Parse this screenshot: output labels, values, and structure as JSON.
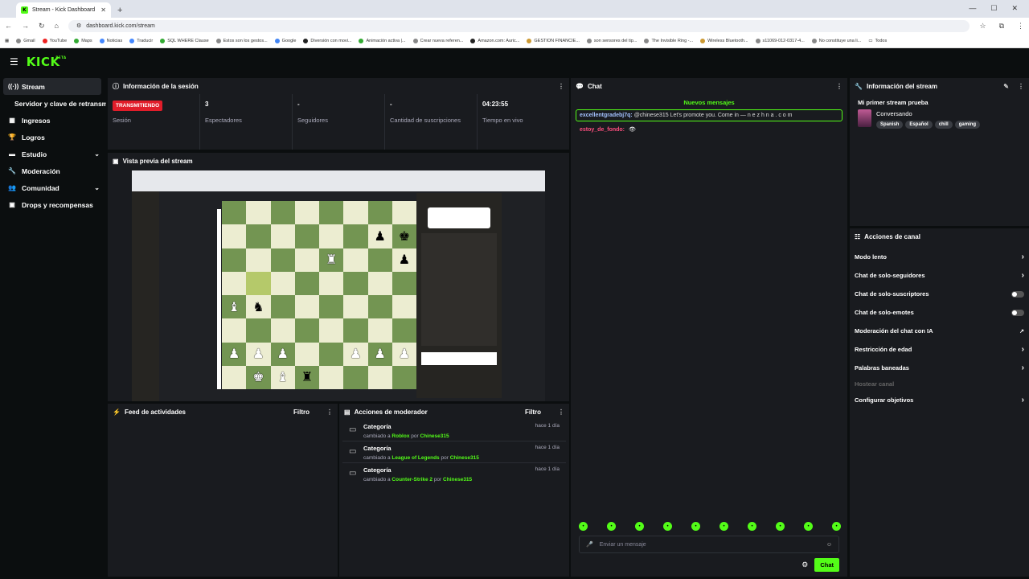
{
  "browser": {
    "tab_title": "Stream - Kick Dashboard",
    "tab_favicon": "K",
    "url": "dashboard.kick.com/stream",
    "bookmarks": [
      "Gmail",
      "YouTube",
      "Maps",
      "Noticias",
      "Traducir",
      "SQL WHERE Clause",
      "Estos son los gestos...",
      "Google",
      "Diversión con movi...",
      "Animación activa |...",
      "Crear nueva referen...",
      "Amazon.com: Auric...",
      "GESTION FINANCIE...",
      "son sensores del tip...",
      "The Invisible Ring -...",
      "Wireless Bluetooth...",
      "s11069-012-0317-4...",
      "No constituye una li...",
      "Todos"
    ]
  },
  "brand": {
    "logo": "KICK",
    "logo_sup": "BETA",
    "accent": "#53fc18"
  },
  "sidebar": {
    "items": [
      {
        "label": "Stream",
        "icon": "stream-icon"
      },
      {
        "label": "Servidor y clave de retransmisión"
      },
      {
        "label": "Ingresos",
        "icon": "revenue-icon"
      },
      {
        "label": "Logros",
        "icon": "trophy-icon"
      },
      {
        "label": "Estudio",
        "icon": "studio-icon"
      },
      {
        "label": "Moderación",
        "icon": "wrench-icon"
      },
      {
        "label": "Comunidad",
        "icon": "community-icon"
      },
      {
        "label": "Drops y recompensas",
        "icon": "drops-icon"
      }
    ]
  },
  "session": {
    "title": "Información de la sesión",
    "stats": [
      {
        "value": "TRANSMITIENDO",
        "label": "Sesión"
      },
      {
        "value": "3",
        "label": "Espectadores"
      },
      {
        "value": "-",
        "label": "Seguidores"
      },
      {
        "value": "-",
        "label": "Cantidad de suscripciones"
      },
      {
        "value": "04:23:55",
        "label": "Tiempo en vivo"
      }
    ]
  },
  "preview": {
    "title": "Vista previa del stream"
  },
  "activity": {
    "title": "Feed de actividades",
    "filter": "Filtro"
  },
  "mod_actions": {
    "title": "Acciones de moderador",
    "filter": "Filtro",
    "items": [
      {
        "title": "Categoría",
        "prefix": "cambiado a",
        "target": "Roblox",
        "by": "por",
        "user": "Chinese315",
        "time": "hace 1 día"
      },
      {
        "title": "Categoría",
        "prefix": "cambiado a",
        "target": "League of Legends",
        "by": "por",
        "user": "Chinese315",
        "time": "hace 1 día"
      },
      {
        "title": "Categoría",
        "prefix": "cambiado a",
        "target": "Counter-Strike 2",
        "by": "por",
        "user": "Chinese315",
        "time": "hace 1 día"
      }
    ]
  },
  "chat": {
    "title": "Chat",
    "new_messages": "Nuevos mensajes",
    "messages": [
      {
        "user": "excellentgradebj7q:",
        "text": "@chinese315 Let's promote you. Come in — n e z h n a . c o m"
      },
      {
        "user": "estoy_de_fondo:",
        "text": ""
      }
    ],
    "input_placeholder": "Enviar un mensaje",
    "send_label": "Chat"
  },
  "stream_info": {
    "title": "Información del stream",
    "stream_title": "Mi primer stream prueba",
    "category": "Conversando",
    "tags": [
      "Spanish",
      "Español",
      "chill",
      "gaming"
    ]
  },
  "channel_actions": {
    "title": "Acciones de canal",
    "items": [
      {
        "label": "Modo lento",
        "control": "chevron"
      },
      {
        "label": "Chat de solo-seguidores",
        "control": "chevron"
      },
      {
        "label": "Chat de solo-suscriptores",
        "control": "toggle"
      },
      {
        "label": "Chat de solo-emotes",
        "control": "toggle"
      },
      {
        "label": "Moderación del chat con IA",
        "control": "external"
      },
      {
        "label": "Restricción de edad",
        "control": "chevron"
      },
      {
        "label": "Palabras baneadas",
        "control": "chevron"
      },
      {
        "label": "Hostear canal",
        "control": "none"
      },
      {
        "label": "Configurar objetivos",
        "control": "chevron"
      }
    ]
  }
}
